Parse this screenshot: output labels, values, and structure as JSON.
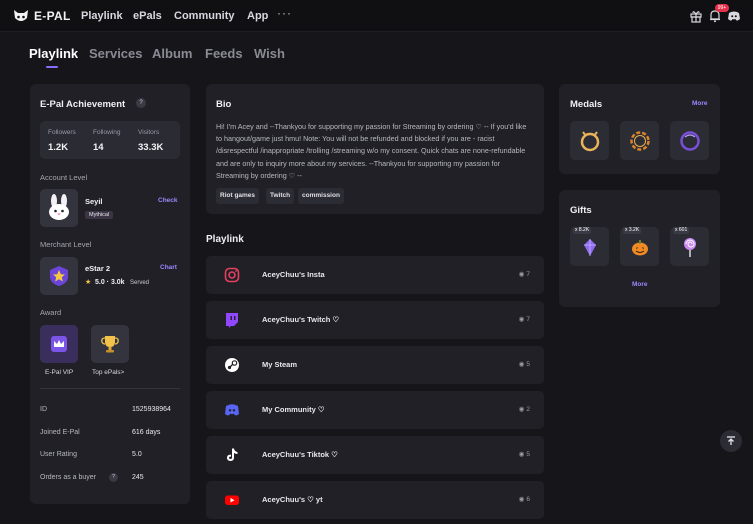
{
  "topnav": {
    "logo_text": "E-PAL",
    "items": [
      "Playlink",
      "ePals",
      "Community",
      "App"
    ],
    "more": "···",
    "notification_badge": "99+"
  },
  "tabs": [
    "Playlink",
    "Services",
    "Album",
    "Feeds",
    "Wish"
  ],
  "achievement": {
    "title": "E-Pal Achievement",
    "help": "?",
    "stats": [
      {
        "label": "Followers",
        "value": "1.2K"
      },
      {
        "label": "Following",
        "value": "14"
      },
      {
        "label": "Visitors",
        "value": "33.3K"
      }
    ],
    "account_level_label": "Account Level",
    "account_name": "Seyil",
    "account_badge": "Mythical",
    "check_label": "Check",
    "merchant_level_label": "Merchant Level",
    "merchant_name": "eStar 2",
    "merchant_rating": "5.0 · 3.0k",
    "merchant_served": "Served",
    "chart_label": "Chart",
    "award_label": "Award",
    "awards": [
      "E-Pal VIP",
      "Top ePals>"
    ],
    "info": [
      {
        "label": "ID",
        "value": "1525938964"
      },
      {
        "label": "Joined E-Pal",
        "value": "616 days"
      },
      {
        "label": "User Rating",
        "value": "5.0"
      },
      {
        "label": "Orders as a buyer",
        "value": "245"
      }
    ]
  },
  "bio": {
    "title": "Bio",
    "text": "Hi! I'm Acey and --Thankyou for supporting my passion for Streaming by ordering ♡ -- If you'd like to hangout/game just hmu! Note: You will not be refunded and blocked if you are - racist /disrespectful /inappropriate /trolling /streaming w/o my consent. Quick chats are none-refundable and are only to inquiry more about my services. --Thankyou for supporting my passion for Streaming by ordering ♡ --",
    "tags": [
      "Riot games",
      "Twitch",
      "commission"
    ]
  },
  "playlink": {
    "title": "Playlink",
    "items": [
      {
        "name": "AceyChuu's Insta",
        "views": "7",
        "icon": "instagram-icon",
        "color": "#e4405f"
      },
      {
        "name": "AceyChuu's Twitch ♡",
        "views": "7",
        "icon": "twitch-icon",
        "color": "#9146ff"
      },
      {
        "name": "My Steam",
        "views": "5",
        "icon": "steam-icon",
        "color": "#ffffff"
      },
      {
        "name": "My Community ♡",
        "views": "2",
        "icon": "discord-icon",
        "color": "#5865f2"
      },
      {
        "name": "AceyChuu's Tiktok ♡",
        "views": "5",
        "icon": "tiktok-icon",
        "color": "#ffffff"
      },
      {
        "name": "AceyChuu's ♡ yt",
        "views": "6",
        "icon": "youtube-icon",
        "color": "#ff0000"
      }
    ]
  },
  "medals": {
    "title": "Medals",
    "more": "More"
  },
  "gifts": {
    "title": "Gifts",
    "items": [
      {
        "count": "x 8.2K",
        "icon": "purple-crystal-icon"
      },
      {
        "count": "x 3.2K",
        "icon": "pumpkin-icon"
      },
      {
        "count": "x 601",
        "icon": "lollipop-icon"
      }
    ],
    "more": "More"
  },
  "colors": {
    "accent": "#8a6bff",
    "background": "#16161a",
    "card": "#202026"
  }
}
